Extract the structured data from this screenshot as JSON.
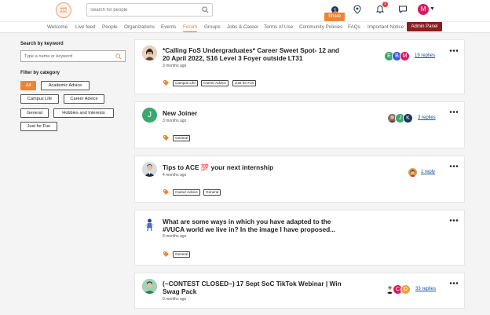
{
  "app": {
    "logo_text": "NUS SOC"
  },
  "search": {
    "placeholder": "Search for people"
  },
  "topbar": {
    "share_tooltip": "Share",
    "compose_symbol": "+",
    "notification_count": "2",
    "user_initial": "M"
  },
  "nav": {
    "items": [
      "Welcome",
      "Live feed",
      "People",
      "Organizations",
      "Events",
      "Forum",
      "Groups",
      "Jobs & Career",
      "Terms of Use",
      "Community Policies",
      "FAQs",
      "Important Notice"
    ],
    "active": "Forum",
    "admin_label": "Admin Panel"
  },
  "sidebar": {
    "keyword_heading": "Search by keyword",
    "keyword_placeholder": "Type a name or keyword",
    "category_heading": "Filter by category",
    "chips": [
      "All",
      "Academic Advice",
      "Campus Life",
      "Career Advice",
      "General",
      "Hobbies and Interests",
      "Just for Fun"
    ],
    "selected": "All"
  },
  "posts": [
    {
      "title": "*Calling FoS Undergraduates* Career Sweet Spot- 12 and 20 April 2022, S16 Level 3 Foyer outside LT31",
      "time": "3 months ago",
      "tags": [
        "Campus Life",
        "Career Advice",
        "Just for Fun"
      ],
      "replies": "19 replies",
      "reply_avatars": [
        {
          "letter": "E",
          "color": "#3aa76d"
        },
        {
          "letter": "B",
          "color": "#3b5bdb"
        },
        {
          "letter": "M",
          "color": "#d81b60"
        }
      ]
    },
    {
      "title": "New Joiner",
      "time": "3 months ago",
      "tags": [
        "General"
      ],
      "replies": "3 replies",
      "author_initial": "J",
      "reply_avatars": [
        {
          "letter": "",
          "color": "#8d6e63"
        },
        {
          "letter": "J",
          "color": "#3aa76d"
        },
        {
          "letter": "K",
          "color": "#1d3557"
        }
      ]
    },
    {
      "title": "Tips to ACE 💯 your next internship",
      "time": "4 months ago",
      "tags": [
        "Career Advice",
        "General"
      ],
      "replies": "1 reply",
      "reply_avatars": [
        {
          "letter": "",
          "color": "#d4a04a"
        }
      ]
    },
    {
      "title": "What are some ways in which you have adapted to the #VUCA world we live in? In the image I have proposed...",
      "time": "8 months ago",
      "tags": [
        "General"
      ],
      "replies": "",
      "reply_avatars": []
    },
    {
      "title": "(~CONTEST CLOSED~) 17 Sept SoC TikTok Webinar | Win Swag Pack",
      "time": "9 months ago",
      "tags": [],
      "replies": "33 replies",
      "reply_avatars": [
        {
          "letter": "",
          "color": "#333"
        },
        {
          "letter": "C",
          "color": "#d81b60"
        },
        {
          "letter": "D",
          "color": "#e8a23a"
        }
      ]
    }
  ],
  "colors": {
    "accent": "#e8873a",
    "admin": "#8b1e1e",
    "link": "#1a4f9c"
  }
}
